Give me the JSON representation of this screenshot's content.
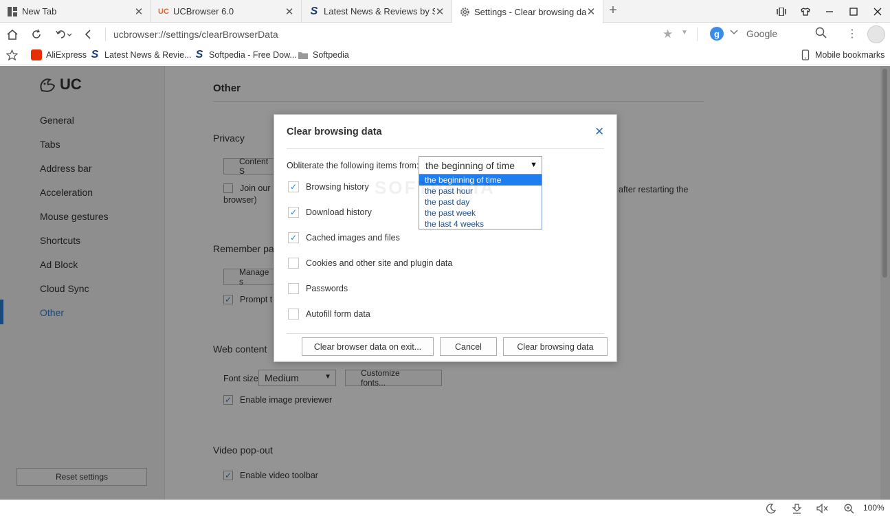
{
  "tabs": [
    {
      "label": "New Tab",
      "icon": "grid-icon"
    },
    {
      "label": "UCBrowser 6.0",
      "icon": "uc-icon"
    },
    {
      "label": "Latest News & Reviews by Softpedia",
      "icon": "softpedia-icon"
    },
    {
      "label": "Settings - Clear browsing data",
      "icon": "gear-icon"
    }
  ],
  "address": {
    "url": "ucbrowser://settings/clearBrowserData"
  },
  "search": {
    "engine_letter": "g",
    "placeholder": "Google"
  },
  "bookmarks": [
    {
      "label": "AliExpress",
      "icon": "aliexpress-icon"
    },
    {
      "label": "Latest News & Revie...",
      "icon": "softpedia-icon"
    },
    {
      "label": "Softpedia - Free Dow...",
      "icon": "softpedia-icon"
    },
    {
      "label": "Softpedia",
      "icon": "folder-icon"
    }
  ],
  "mobile_bookmarks": "Mobile bookmarks",
  "sidebar": {
    "logo": "UC",
    "items": [
      {
        "label": "General"
      },
      {
        "label": "Tabs"
      },
      {
        "label": "Address bar"
      },
      {
        "label": "Acceleration"
      },
      {
        "label": "Mouse gestures"
      },
      {
        "label": "Shortcuts"
      },
      {
        "label": "Ad Block"
      },
      {
        "label": "Cloud Sync"
      },
      {
        "label": "Other"
      }
    ],
    "active": "Other",
    "reset_label": "Reset settings"
  },
  "settings": {
    "heading": "Other",
    "privacy": {
      "title": "Privacy",
      "content_button": "Content S",
      "join_label": "Join our U",
      "join_suffix": "after restarting the",
      "join_wrap": "browser)"
    },
    "passwords": {
      "title": "Remember pas",
      "manage_button": "Manage s",
      "prompt_label": "Prompt t"
    },
    "web_content": {
      "title": "Web content",
      "font_size_label": "Font size:",
      "font_size_value": "Medium",
      "customize_button": "Customize fonts...",
      "image_previewer": "Enable image previewer"
    },
    "video": {
      "title": "Video pop-out",
      "toolbar_label": "Enable video toolbar"
    }
  },
  "dialog": {
    "title": "Clear browsing data",
    "obliterate_label": "Obliterate the following items from:",
    "selected_range": "the beginning of time",
    "range_options": [
      "the beginning of time",
      "the past hour",
      "the past day",
      "the past week",
      "the last 4 weeks"
    ],
    "items": [
      {
        "label": "Browsing history",
        "checked": true
      },
      {
        "label": "Download history",
        "checked": true
      },
      {
        "label": "Cached images and files",
        "checked": true
      },
      {
        "label": "Cookies and other site and plugin data",
        "checked": false
      },
      {
        "label": "Passwords",
        "checked": false
      },
      {
        "label": "Autofill form data",
        "checked": false
      }
    ],
    "buttons": {
      "on_exit": "Clear browser data on exit...",
      "cancel": "Cancel",
      "clear": "Clear browsing data"
    }
  },
  "status": {
    "zoom": "100%"
  },
  "watermark": "SOFTPEDIA",
  "colors": {
    "accent": "#2f7fd6",
    "selection": "#1e7df0",
    "aliexpress": "#e62e04",
    "softpedia": "#1a3b7a"
  }
}
